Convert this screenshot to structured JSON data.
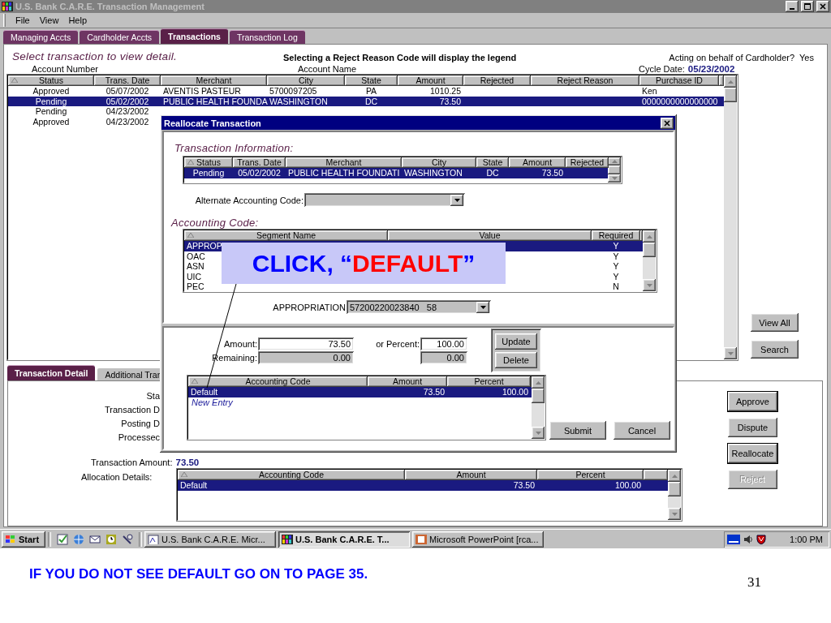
{
  "window": {
    "title": "U.S. Bank C.A.R.E. Transaction Management"
  },
  "menu": [
    "File",
    "View",
    "Help"
  ],
  "tabs": [
    {
      "label": "Managing Accts",
      "selected": false
    },
    {
      "label": "Cardholder Accts",
      "selected": false
    },
    {
      "label": "Transactions",
      "selected": true
    },
    {
      "label": "Transaction Log",
      "selected": false
    }
  ],
  "header": {
    "instruction": "Select transaction to view detail.",
    "legend_note": "Selecting a Reject Reason Code will display the legend",
    "acting_label": "Acting on behalf of Cardholder?",
    "acting_value": "Yes",
    "account_number_label": "Account Number",
    "account_name_label": "Account Name",
    "cycle_date_label": "Cycle Date:",
    "cycle_date": "05/23/2002"
  },
  "transactions": {
    "columns": [
      "Status",
      "Trans. Date",
      "Merchant",
      "City",
      "State",
      "Amount",
      "Rejected",
      "Reject Reason",
      "Purchase ID"
    ],
    "rows": [
      {
        "selected": false,
        "cells": [
          "Approved",
          "05/07/2002",
          "AVENTIS PASTEUR",
          "5700097205",
          "PA",
          "1010.25",
          "",
          "",
          "Ken"
        ]
      },
      {
        "selected": true,
        "cells": [
          "Pending",
          "05/02/2002",
          "PUBLIC HEALTH FOUNDA",
          "WASHINGTON",
          "DC",
          "73.50",
          "",
          "",
          "0000000000000000"
        ]
      },
      {
        "selected": false,
        "cells": [
          "Pending",
          "04/23/2002"
        ]
      },
      {
        "selected": false,
        "cells": [
          "Approved",
          "04/23/2002"
        ]
      }
    ]
  },
  "side_buttons": [
    "View All",
    "Search"
  ],
  "detail_tabs": [
    {
      "label": "Transaction Detail",
      "selected": true
    },
    {
      "label": "Additional Tran",
      "selected": false
    }
  ],
  "detail": {
    "fields": [
      "Sta",
      "Transaction D",
      "Posting D",
      "Processec"
    ],
    "amount_label": "Transaction Amount:",
    "amount": "73.50",
    "allocation_label": "Allocation Details:",
    "allocation": {
      "columns": [
        "Accounting Code",
        "Amount",
        "Percent"
      ],
      "rows": [
        {
          "selected": true,
          "cells": [
            "Default",
            "73.50",
            "100.00"
          ]
        }
      ]
    }
  },
  "action_buttons": [
    {
      "label": "Approve",
      "disabled": false
    },
    {
      "label": "Dispute",
      "disabled": false
    },
    {
      "label": "Reallocate",
      "disabled": false
    },
    {
      "label": "Reject",
      "disabled": true
    }
  ],
  "dialog": {
    "title": "Reallocate Transaction",
    "transaction_heading": "Transaction Information:",
    "transaction_table": {
      "columns": [
        "Status",
        "Trans. Date",
        "Merchant",
        "City",
        "State",
        "Amount",
        "Rejected"
      ],
      "rows": [
        {
          "selected": true,
          "cells": [
            "Pending",
            "05/02/2002",
            "PUBLIC HEALTH FOUNDATI",
            "WASHINGTON",
            "DC",
            "73.50",
            ""
          ]
        }
      ]
    },
    "alt_code_label": "Alternate Accounting Code:",
    "accounting_heading": "Accounting Code:",
    "segments": {
      "columns": [
        "Segment Name",
        "Value",
        "Required"
      ],
      "rows": [
        {
          "selected": true,
          "cells": [
            "APPROP",
            "",
            "Y"
          ]
        },
        {
          "selected": false,
          "cells": [
            "OAC",
            "",
            "Y"
          ]
        },
        {
          "selected": false,
          "cells": [
            "ASN",
            "",
            "Y"
          ]
        },
        {
          "selected": false,
          "cells": [
            "UIC",
            "",
            "Y"
          ]
        },
        {
          "selected": false,
          "cells": [
            "PEC",
            "",
            "N"
          ]
        }
      ]
    },
    "segment_label": "APPROPRIATION",
    "segment_value": "57200220023840   58",
    "amount_label": "Amount:",
    "amount": "73.50",
    "percent_label": "or Percent:",
    "percent": "100.00",
    "remaining_label": "Remaining:",
    "remaining_amount": "0.00",
    "remaining_percent": "0.00",
    "update": "Update",
    "delete": "Delete",
    "allocations": {
      "columns": [
        "Accounting Code",
        "Amount",
        "Percent"
      ],
      "rows": [
        {
          "selected": true,
          "cells": [
            "Default",
            "73.50",
            "100.00"
          ]
        }
      ],
      "new_entry": "New Entry"
    },
    "submit": "Submit",
    "cancel": "Cancel"
  },
  "callout": {
    "parts": [
      {
        "text": "CLICK, “",
        "color": "#0000ff"
      },
      {
        "text": "DEFAULT",
        "color": "#ff0000"
      },
      {
        "text": "”",
        "color": "#0000ff"
      }
    ]
  },
  "taskbar": {
    "start": "Start",
    "tasks": [
      {
        "label": "U.S. Bank C.A.R.E.   Micr...",
        "selected": false
      },
      {
        "label": "U.S. Bank C.A.R.E. T...",
        "selected": true
      },
      {
        "label": "Microsoft PowerPoint   [rca...",
        "selected": false
      }
    ],
    "clock": "1:00 PM"
  },
  "slide": {
    "note": "IF YOU DO NOT SEE DEFAULT GO ON TO PAGE 35.",
    "page_number": "31"
  }
}
